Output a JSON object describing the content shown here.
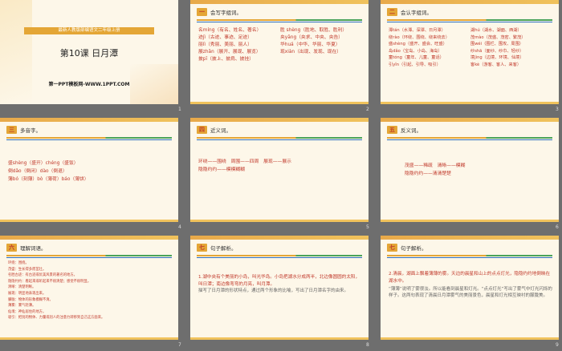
{
  "slides": [
    {
      "num": "1",
      "band": "最新人教版部编语文二年级上册",
      "title": "第10课 日月潭",
      "sub": "第一PPT模板网-WWW.1PPT.COM"
    },
    {
      "num": "2",
      "badge": "一",
      "heading": "会写字组词。",
      "left": [
        "名míng（有名、姓名、著名）",
        "迹jì（古迹、事迹、足迹）",
        "丽lì（秀丽、美丽、丽人）",
        "展zhǎn（展开、展现、展览）",
        "披pī（披上、披肩、披挂）"
      ],
      "right": [
        "胜 shèng（胜地、取胜、胜利）",
        "央yāng（央求、中央、央告）",
        "华huá（中华、华丽、华夏）",
        "现xiàn（出现、发现、现在）"
      ]
    },
    {
      "num": "3",
      "badge": "二",
      "heading": "会认字组词。",
      "left": [
        "潭tán（水潭、深潭、日月潭）",
        "绕rào（环绕、围绕、绕来绕去）",
        "盛shèng（盛开、盛会、旺盛）",
        "岛dǎo（宝岛、小岛、海岛）",
        "童tóng（童年、儿童、童话）",
        "引yǐn（引起、引导、吸引）"
      ],
      "right": [
        "湖hú（湖水、湖面、西湖）",
        "茂mào（茂盛、茂密、繁茂）",
        "围wéi（围栏、围攻、周围）",
        "纱shā（面纱、纱巾、轻纱）",
        "境jìng（边境、环境、仙境）",
        "客kè（游客、客人、来客）"
      ]
    },
    {
      "num": "4",
      "badge": "三",
      "heading": "多音字。",
      "lines": [
        "盛shèng（盛开）chéng（盛饭）",
        "倒dǎo（倒闭）dào（倒退）",
        "薄bó（刻薄）bò（薄荷）báo（薄饼）"
      ]
    },
    {
      "num": "5",
      "badge": "四",
      "heading": "近义词。",
      "lines": [
        "环绕——围绕　周围——四周　展现——展示",
        "隐隐约约——模模糊糊"
      ]
    },
    {
      "num": "6",
      "badge": "五",
      "heading": "反义词。",
      "lines": [
        "茂盛——稀疏　清晰——模糊",
        "隐隐约约——清清楚楚"
      ]
    },
    {
      "num": "7",
      "badge": "六",
      "heading": "理解词语。",
      "lines": [
        "环绕：围绕。",
        "茂盛：生长得多而茁壮。",
        "名胜古迹：有古迹或优美风景的著名的地方。",
        "隐隐约约：看起来或听起来不很清楚；感觉不很明显。",
        "清晰：清楚明晰。",
        "展现：明显地表现出来。",
        "朦胧：物体的形象模糊不清。",
        "薄雾：雾气轻薄。",
        "仙境：神仙居住的地方。",
        "吸引：把别的物体、力量或别人的注意力转移到自己这方面来。"
      ]
    },
    {
      "num": "8",
      "badge": "七",
      "heading": "句子解析。",
      "quote": "1.湖中央有个美丽的小岛，叫光华岛。小岛把湖水分成两半，北边像圆圆的太阳，叫日潭；南边像弯弯的月亮，叫月潭。",
      "note": "描写了日月潭的形状特点，通过两个形象的比喻，写出了日月潭名字的由来。"
    },
    {
      "num": "9",
      "badge": "七",
      "heading": "句子解析。",
      "quote": "2.清晨，湖面上飘着薄薄的雾。天边的晨星和山上的点点灯光，隐隐约约地倒映在湖水中。",
      "note": "“薄薄”说明了雾很淡。所以能看到晨星和灯光。“点点灯光”写出了雾气中灯光闪烁的样子。这两句表现了清晨日月潭雾气的美丽景色，晨星和灯光相互映衬的朦胧美。"
    }
  ]
}
